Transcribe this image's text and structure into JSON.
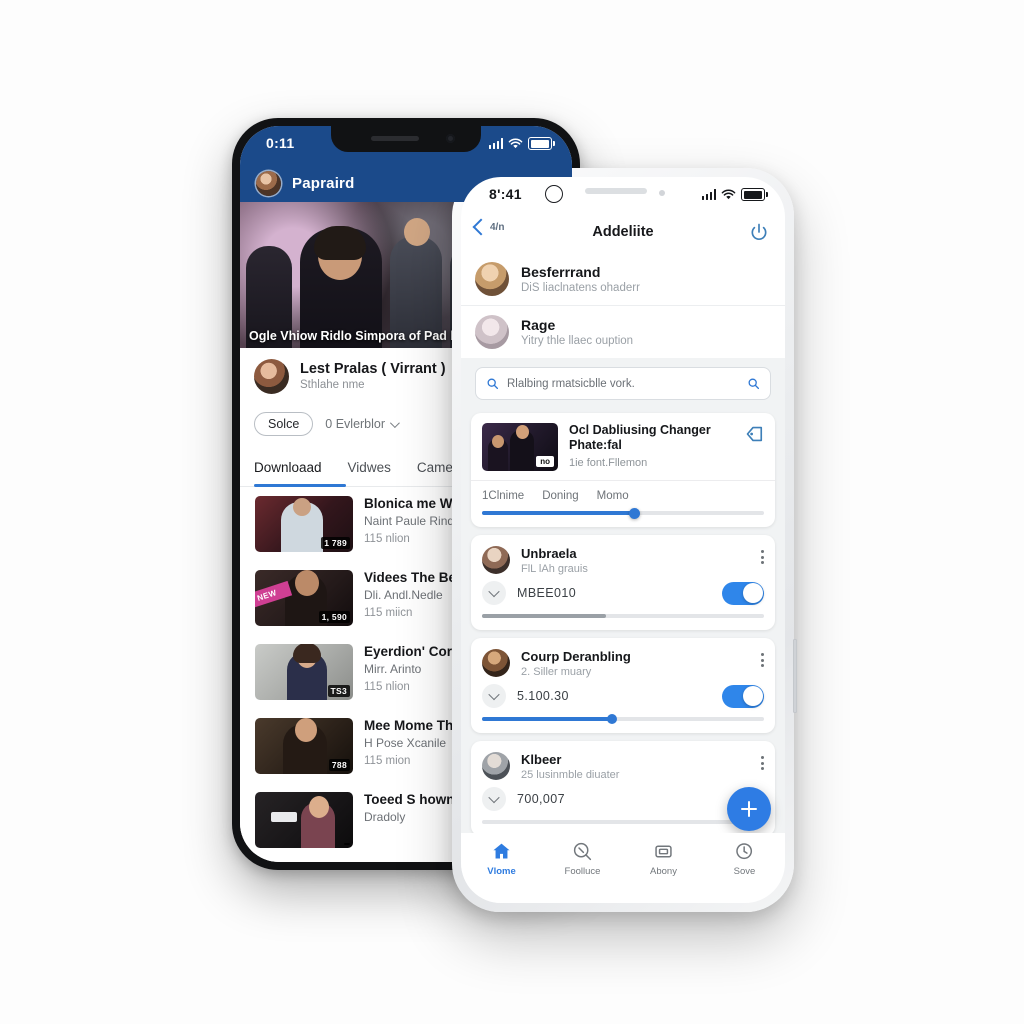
{
  "accent": {
    "navy": "#1b4a8a",
    "blue": "#2f78d4",
    "fab_blue": "#2e7ce4",
    "toggle_blue": "#2f86ea",
    "muted_text": "#8f9398"
  },
  "back_phone": {
    "status_bar": {
      "time": "0:11"
    },
    "app_bar": {
      "title": "Papraird"
    },
    "hero": {
      "caption": "Ogle Vhiow Ridlo Simpora of Pad bi: Gxaloend"
    },
    "channel": {
      "name": "Lest Pralas ( Virrant )",
      "subtitle": "Sthlahe nme"
    },
    "filters": {
      "pill_label": "Solce",
      "dropdown_label": "0 Evlerblor"
    },
    "tabs": [
      {
        "label": "Downloaad",
        "active": true
      },
      {
        "label": "Vidwes",
        "active": false
      },
      {
        "label": "Came",
        "active": false
      }
    ],
    "videos": [
      {
        "title": "Blonica me With",
        "channel": "Naint Paule Rind",
        "stats": "115 nlion",
        "duration": "1 789",
        "tag": ""
      },
      {
        "title": "Videes The Bes",
        "channel": "Dli. Andl.Nedle",
        "stats": "115 miicn",
        "duration": "1, 590",
        "tag": "NEW"
      },
      {
        "title": "Eyerdion' Corn",
        "channel": "Mirr. Arinto",
        "stats": "115 nlion",
        "duration": "TS3",
        "tag": ""
      },
      {
        "title": "Mee Mome The",
        "channel": "H Pose Xcanile",
        "stats": "115 mion",
        "duration": "788",
        "tag": ""
      },
      {
        "title": "Toeed S howne",
        "channel": "Dradoly",
        "stats": "",
        "duration": "",
        "tag": ""
      }
    ]
  },
  "front_phone": {
    "status_bar": {
      "time": "8':41"
    },
    "header": {
      "back_label": "4/n",
      "title": "Addeliite",
      "power_icon": "power-icon"
    },
    "contacts": [
      {
        "name": "Besferrrand",
        "subtitle": "DiS liaclnatens ohaderr"
      },
      {
        "name": "Rage",
        "subtitle": "Yitry thle llaec ouption"
      }
    ],
    "search": {
      "value": "Rlalbing rmatsicblle vork.",
      "leading_icon": "search-icon",
      "trailing_icon": "search-icon"
    },
    "media_card": {
      "title": "Ocl Dabliusing Changer Phate:fal",
      "subtitle": "1ie font.Fllemon",
      "thumb_label": "no",
      "action_icon": "tag-icon",
      "chips": [
        "1Clnime",
        "Doning",
        "Momo"
      ],
      "slider_percent": 54
    },
    "items": [
      {
        "title": "Unbraela",
        "subtitle": "FlL lAh grauis",
        "value": "MBEE010",
        "toggle_on": true,
        "bar_percent": 44,
        "bar_color": "#9aa0a6"
      },
      {
        "title": "Courp Deranbling",
        "subtitle": "2. Siller muary",
        "value": "5.100.30",
        "toggle_on": true,
        "bar_percent": 46,
        "bar_color": "#2f78d4"
      },
      {
        "title": "Klbeer",
        "subtitle": "25 lusinmble diuater",
        "value": "700,007",
        "toggle_on": false,
        "bar_percent": 0,
        "bar_color": "#2f78d4"
      }
    ],
    "fab": {
      "label": "+",
      "icon": "plus-icon"
    },
    "bottom_nav": [
      {
        "label": "Vlome",
        "icon": "home-icon",
        "active": true
      },
      {
        "label": "Foolluce",
        "icon": "search-icon",
        "active": false
      },
      {
        "label": "Abony",
        "icon": "inbox-icon",
        "active": false
      },
      {
        "label": "Sove",
        "icon": "clock-icon",
        "active": false
      }
    ]
  }
}
